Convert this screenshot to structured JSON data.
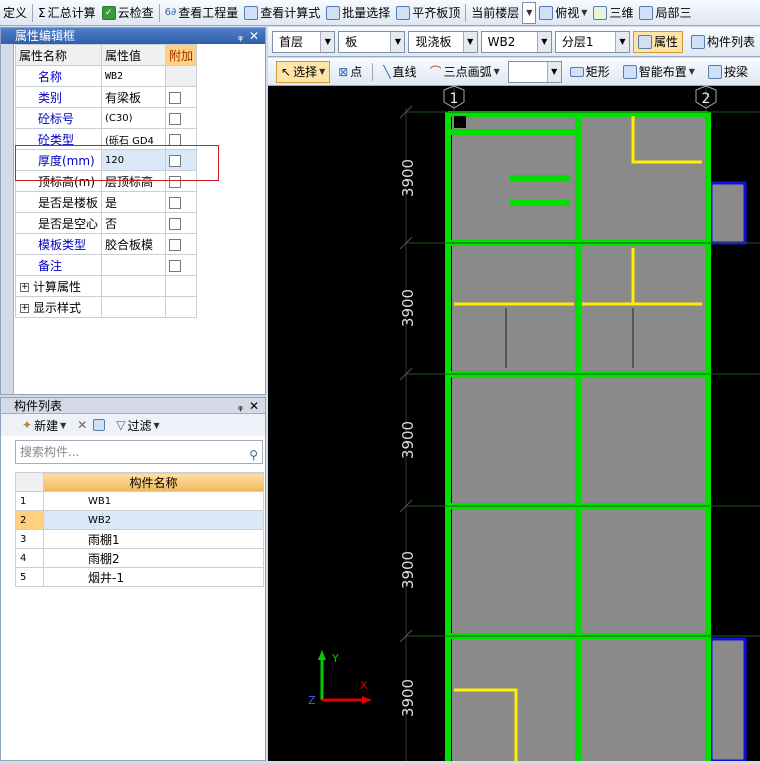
{
  "toolbar": {
    "define_label": "定义",
    "sum_calc_label": "汇总计算",
    "cloud_check_label": "云检查",
    "view_quantity_label": "查看工程量",
    "view_formula_label": "查看计算式",
    "batch_select_label": "批量选择",
    "align_slab_top_label": "平齐板顶",
    "current_floor_label": "当前楼层",
    "top_view_label": "俯视",
    "three_d_label": "三维",
    "partial_label": "局部三"
  },
  "prop_panel": {
    "title": "属性编辑框",
    "headers": {
      "name": "属性名称",
      "value": "属性值",
      "extra": "附加"
    },
    "rows": [
      {
        "name": "名称",
        "value": "WB2",
        "has_cb": false
      },
      {
        "name": "类别",
        "value": "有梁板",
        "has_cb": true
      },
      {
        "name": "砼标号",
        "value": "(C30)",
        "has_cb": true
      },
      {
        "name": "砼类型",
        "value": "(砾石 GD4",
        "has_cb": true
      },
      {
        "name": "厚度(mm)",
        "value": "120",
        "has_cb": true
      },
      {
        "name": "顶标高(m)",
        "value": "层顶标高",
        "has_cb": true
      },
      {
        "name": "是否是楼板",
        "value": "是",
        "has_cb": true
      },
      {
        "name": "是否是空心",
        "value": "否",
        "has_cb": true
      },
      {
        "name": "模板类型",
        "value": "胶合板模",
        "has_cb": true
      },
      {
        "name": "备注",
        "value": "",
        "has_cb": true
      }
    ],
    "groups": [
      "计算属性",
      "显示样式"
    ]
  },
  "comp_panel": {
    "title": "构件列表",
    "new_label": "新建",
    "filter_label": "过滤",
    "search_placeholder": "搜索构件...",
    "column_header": "构件名称",
    "rows": [
      {
        "num": "1",
        "name": "WB1"
      },
      {
        "num": "2",
        "name": "WB2"
      },
      {
        "num": "3",
        "name": "雨棚1"
      },
      {
        "num": "4",
        "name": "雨棚2"
      },
      {
        "num": "5",
        "name": "烟井-1"
      }
    ]
  },
  "second_toolbar": {
    "floor": "首层",
    "type": "板",
    "subtype": "现浇板",
    "member": "WB2",
    "layer": "分层1",
    "attr_label": "属性",
    "comp_list_label": "构件列表"
  },
  "third_toolbar": {
    "select_label": "选择",
    "point_label": "点",
    "line_label": "直线",
    "arc_label": "三点画弧",
    "rect_label": "矩形",
    "smart_layout_label": "智能布置",
    "by_label": "按梁"
  },
  "drawing": {
    "axis_labels": [
      "1",
      "2"
    ],
    "dimension_label": "3900",
    "axis_y": "Y",
    "axis_x": "X",
    "axis_z": "Z"
  }
}
